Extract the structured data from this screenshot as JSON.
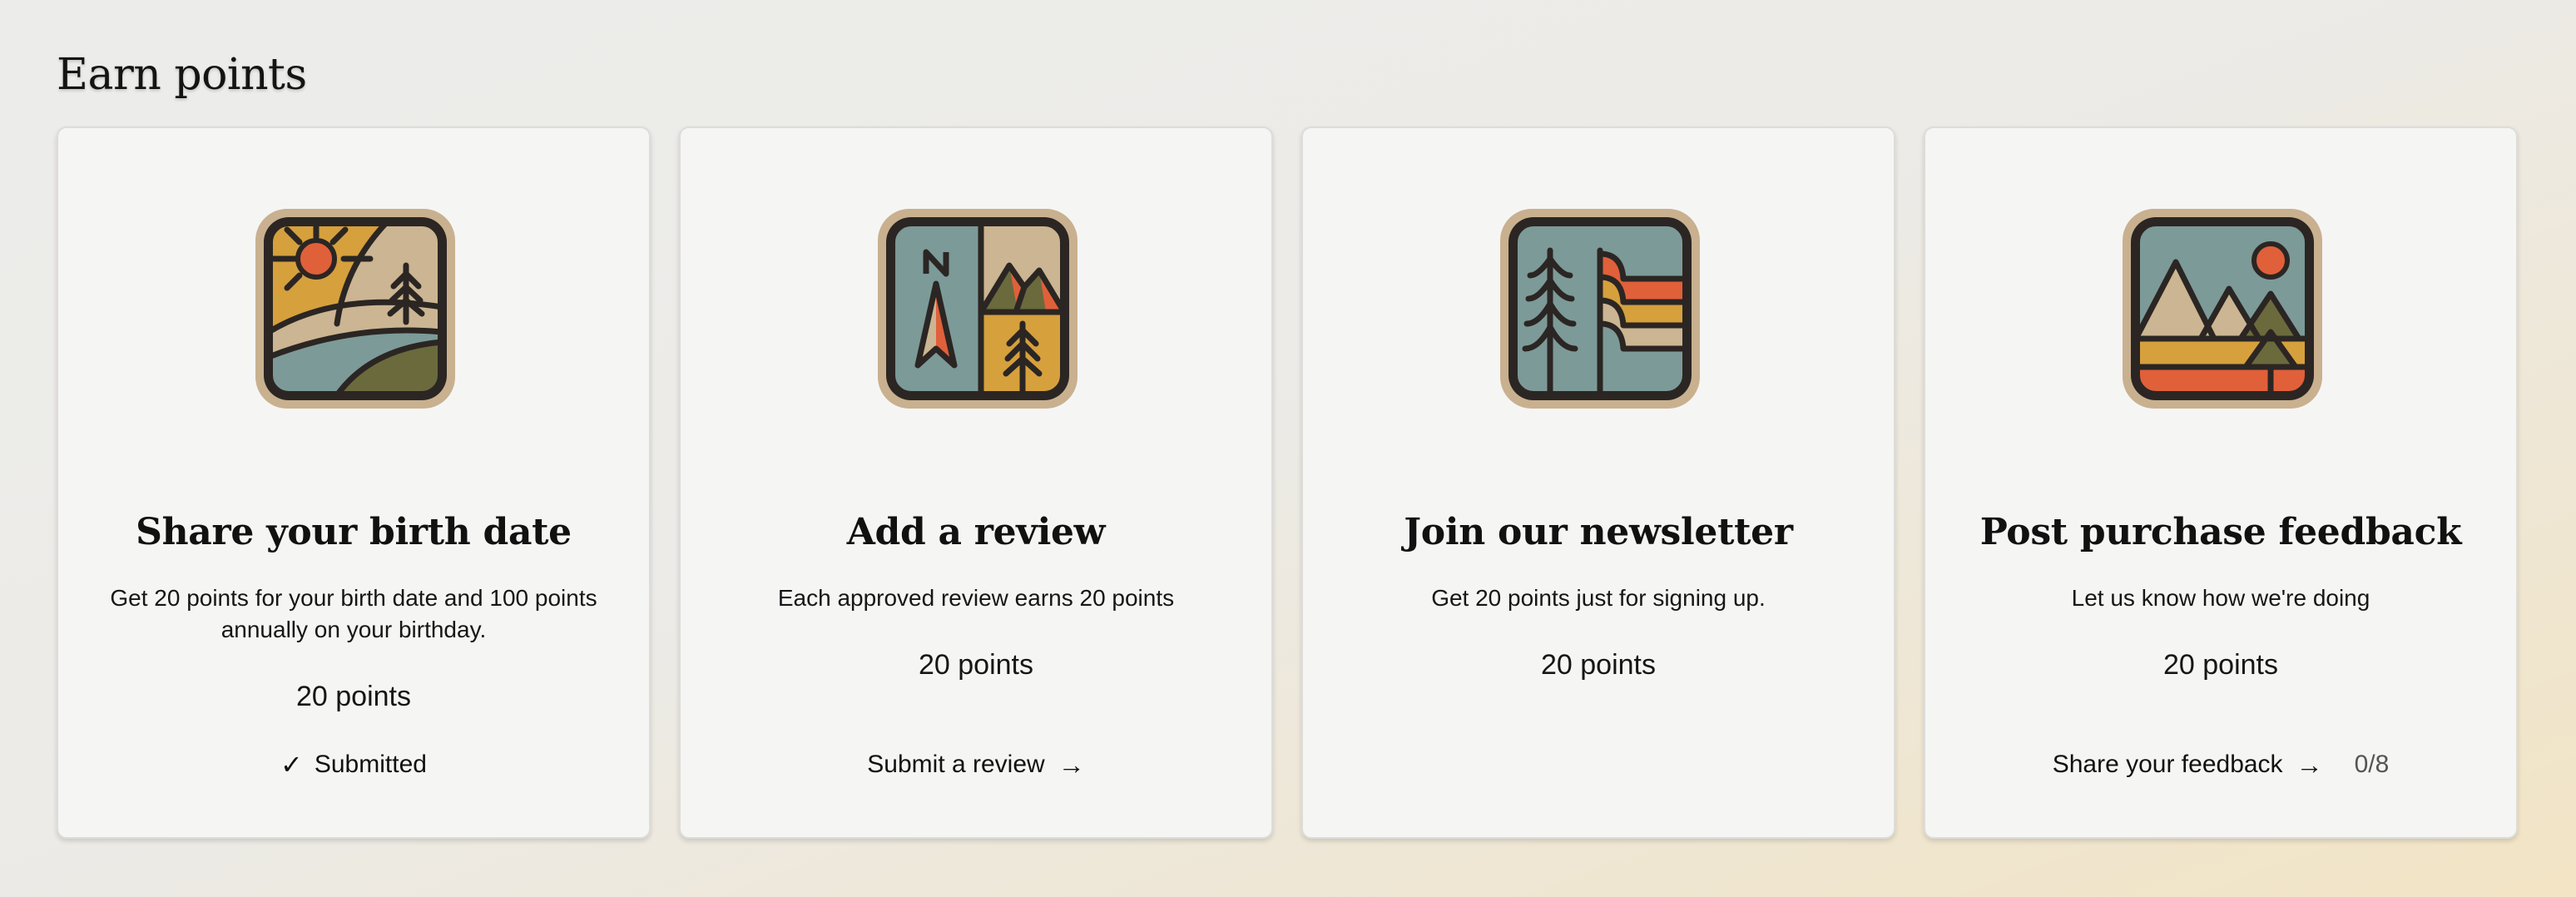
{
  "section": {
    "title": "Earn points"
  },
  "cards": [
    {
      "title": "Share your birth date",
      "description": "Get 20 points for your birth date and 100 points annually on your birthday.",
      "points": "20 points",
      "action": {
        "label": "Submitted",
        "icon": "checkmark-icon",
        "state": "completed"
      }
    },
    {
      "title": "Add a review",
      "description": "Each approved review earns 20 points",
      "points": "20 points",
      "action": {
        "label": "Submit a review",
        "icon": "arrow-right-icon"
      }
    },
    {
      "title": "Join our newsletter",
      "description": "Get 20 points just for signing up.",
      "points": "20 points"
    },
    {
      "title": "Post purchase feedback",
      "description": "Let us know how we're doing",
      "points": "20 points",
      "action": {
        "label": "Share your feedback",
        "icon": "arrow-right-icon",
        "counter": "0/8"
      }
    }
  ],
  "icons": [
    "landscape-sun-icon",
    "compass-mountain-icon",
    "tree-flag-icon",
    "mountain-sunset-icon"
  ],
  "colors": {
    "ink": "#2b2623",
    "frame": "#c9b08f",
    "teal": "#7c9a98",
    "mustard": "#d6a03d",
    "sand": "#cbb592",
    "orange": "#e0603a",
    "olive": "#6a6a3d"
  }
}
